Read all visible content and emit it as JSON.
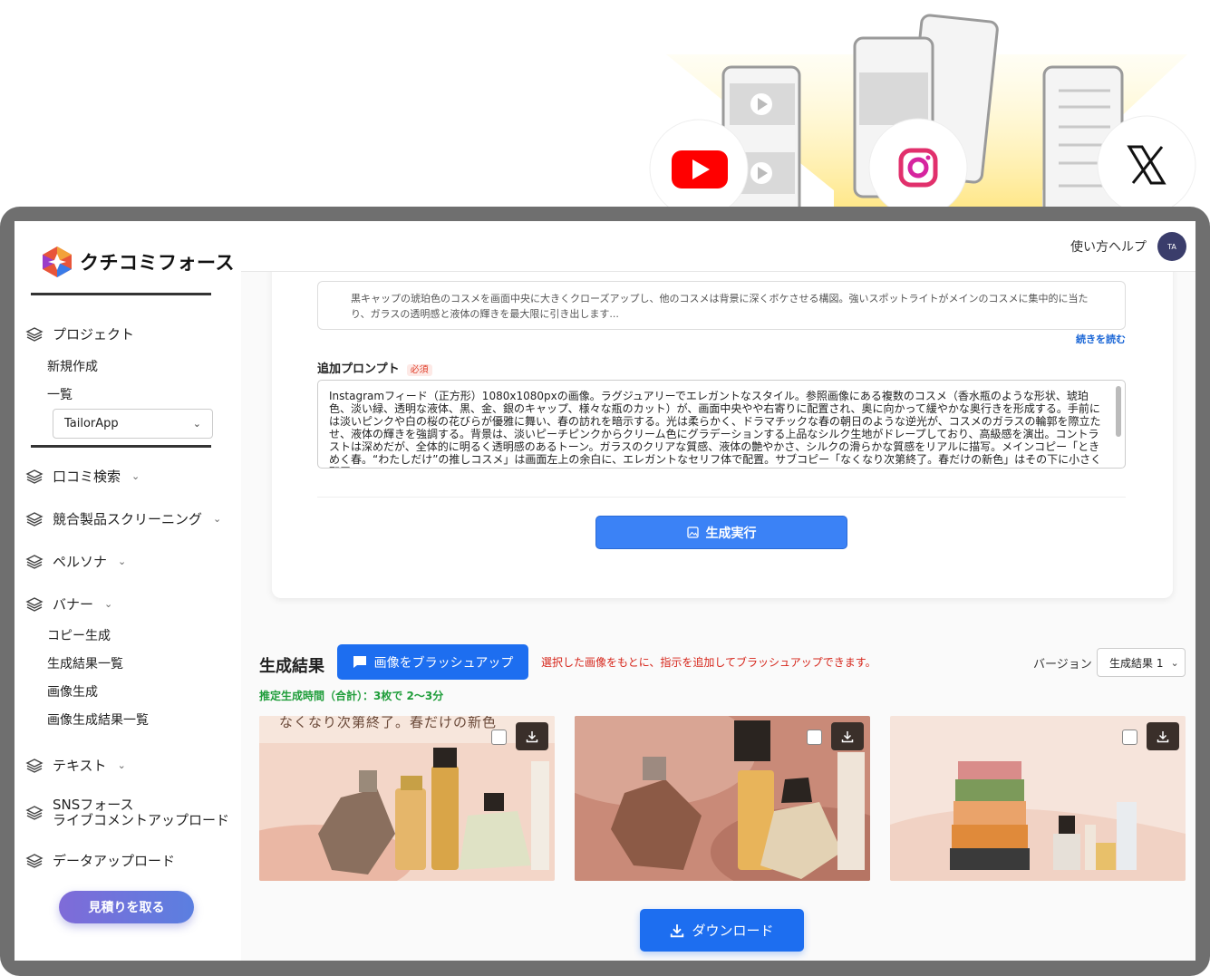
{
  "app": {
    "logo_text": "クチコミフォース"
  },
  "header": {
    "help": "使い方ヘルプ",
    "avatar": "TA"
  },
  "sidebar": {
    "project": "プロジェクト",
    "new": "新規作成",
    "list": "一覧",
    "app_select": "TailorApp",
    "reviews": "口コミ検索",
    "screening": "競合製品スクリーニング",
    "persona": "ペルソナ",
    "banner": "バナー",
    "copy_gen": "コピー生成",
    "gen_results": "生成結果一覧",
    "image_gen": "画像生成",
    "image_results": "画像生成結果一覧",
    "text": "テキスト",
    "sns_line1": "SNSフォース",
    "sns_line2": "ライブコメントアップロード",
    "data_upload": "データアップロード",
    "estimate": "見積りを取る"
  },
  "form": {
    "description": "黒キャップの琥珀色のコスメを画面中央に大きくクローズアップし、他のコスメは背景に深くボケさせる構図。強いスポットライトがメインのコスメに集中的に当たり、ガラスの透明感と液体の輝きを最大限に引き出します...",
    "read_more": "続きを読む",
    "prompt_label": "追加プロンプト",
    "required": "必須",
    "prompt_text": "Instagramフィード（正方形）1080x1080pxの画像。ラグジュアリーでエレガントなスタイル。参照画像にある複数のコスメ（香水瓶のような形状、琥珀色、淡い緑、透明な液体、黒、金、銀のキャップ、様々な瓶のカット）が、画面中央やや右寄りに配置され、奥に向かって緩やかな奥行きを形成する。手前には淡いピンクや白の桜の花びらが優雅に舞い、春の訪れを暗示する。光は柔らかく、ドラマチックな春の朝日のような逆光が、コスメのガラスの輪郭を際立たせ、液体の輝きを強調する。背景は、淡いピーチピンクからクリーム色にグラデーションする上品なシルク生地がドレープしており、高級感を演出。コントラストは深めだが、全体的に明るく透明感のあるトーン。ガラスのクリアな質感、液体の艶やかさ、シルクの滑らかな質感をリアルに描写。メインコピー「ときめく春。“わたしだけ”の推しコスメ」は画面左上の余白に、エレガントなセリフ体で配置。サブコピー「なくなり次第終了。春だけの新色」はその下に小さく配置。",
    "generate": "生成実行"
  },
  "results": {
    "title": "生成結果",
    "brushup": "画像をブラッシュアップ",
    "notice": "選択した画像をもとに、指示を追加してブラッシュアップできます。",
    "version_label": "バージョン",
    "version_value": "生成結果 1",
    "estimated_time": "推定生成時間（合計）：3枚で 2〜3分",
    "image1_overlay": "なくなり次第終了。春だけの新色",
    "download": "ダウンロード"
  },
  "icons": {
    "sns": [
      "youtube-icon",
      "instagram-icon",
      "x-icon"
    ]
  },
  "colors": {
    "primary": "#1d6ef0",
    "notice": "#d6261b",
    "time": "#1f9d3a"
  }
}
